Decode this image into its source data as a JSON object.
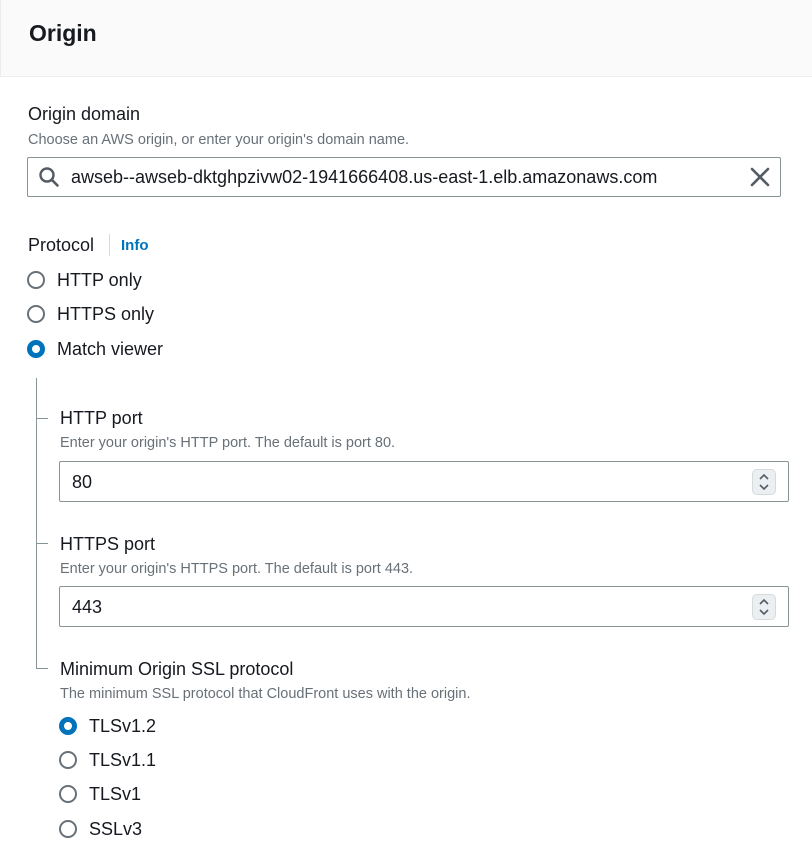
{
  "header": {
    "title": "Origin"
  },
  "origin_domain": {
    "label": "Origin domain",
    "description": "Choose an AWS origin, or enter your origin's domain name.",
    "value": "awseb--awseb-dktghpzivw02-1941666408.us-east-1.elb.amazonaws.com"
  },
  "protocol": {
    "label": "Protocol",
    "info": "Info",
    "options": [
      {
        "label": "HTTP only",
        "checked": false
      },
      {
        "label": "HTTPS only",
        "checked": false
      },
      {
        "label": "Match viewer",
        "checked": true
      }
    ]
  },
  "http_port": {
    "label": "HTTP port",
    "description": "Enter your origin's HTTP port. The default is port 80.",
    "value": "80"
  },
  "https_port": {
    "label": "HTTPS port",
    "description": "Enter your origin's HTTPS port. The default is port 443.",
    "value": "443"
  },
  "min_ssl": {
    "label": "Minimum Origin SSL protocol",
    "description": "The minimum SSL protocol that CloudFront uses with the origin.",
    "options": [
      {
        "label": "TLSv1.2",
        "checked": true
      },
      {
        "label": "TLSv1.1",
        "checked": false
      },
      {
        "label": "TLSv1",
        "checked": false
      },
      {
        "label": "SSLv3",
        "checked": false
      }
    ]
  },
  "colors": {
    "accent": "#0073bb",
    "text": "#16191f",
    "muted": "#687078",
    "border": "#879596"
  },
  "icons": {
    "search": "search-icon",
    "clear": "close-icon",
    "stepper": "stepper-icon"
  }
}
